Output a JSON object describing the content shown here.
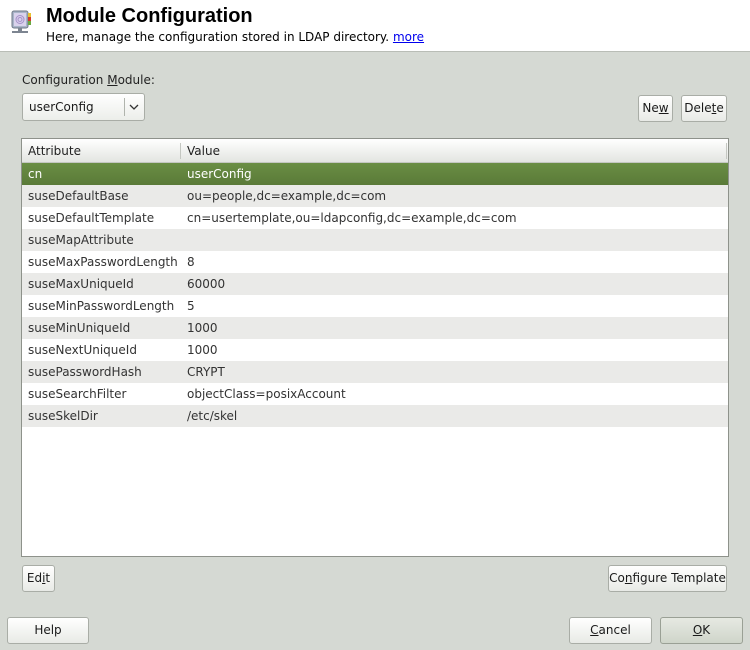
{
  "header": {
    "icon": "ldap-config-computer-icon",
    "title": "Module Configuration",
    "subtitle": "Here, manage the configuration stored in LDAP directory.",
    "more_link": "more"
  },
  "module_selector": {
    "label_prefix": "Configuration ",
    "label_mnemonic": "M",
    "label_suffix": "odule:",
    "selected": "userConfig"
  },
  "toolbar": {
    "new": {
      "pre": "Ne",
      "mn": "w",
      "post": ""
    },
    "delete": {
      "pre": "Dele",
      "mn": "t",
      "post": "e"
    }
  },
  "table": {
    "columns": [
      "Attribute",
      "Value"
    ],
    "rows": [
      {
        "attribute": "cn",
        "value": "userConfig",
        "selected": true
      },
      {
        "attribute": "suseDefaultBase",
        "value": "ou=people,dc=example,dc=com"
      },
      {
        "attribute": "suseDefaultTemplate",
        "value": "cn=usertemplate,ou=ldapconfig,dc=example,dc=com"
      },
      {
        "attribute": "suseMapAttribute",
        "value": ""
      },
      {
        "attribute": "suseMaxPasswordLength",
        "value": "8"
      },
      {
        "attribute": "suseMaxUniqueId",
        "value": "60000"
      },
      {
        "attribute": "suseMinPasswordLength",
        "value": "5"
      },
      {
        "attribute": "suseMinUniqueId",
        "value": "1000"
      },
      {
        "attribute": "suseNextUniqueId",
        "value": "1000"
      },
      {
        "attribute": "susePasswordHash",
        "value": "CRYPT"
      },
      {
        "attribute": "suseSearchFilter",
        "value": "objectClass=posixAccount"
      },
      {
        "attribute": "suseSkelDir",
        "value": "/etc/skel"
      }
    ]
  },
  "actions": {
    "edit": {
      "pre": "Ed",
      "mn": "i",
      "post": "t"
    },
    "configure_template": {
      "pre": "Co",
      "mn": "n",
      "post": "figure Template"
    }
  },
  "footer": {
    "help": "Help",
    "cancel": {
      "pre": "",
      "mn": "C",
      "post": "ancel"
    },
    "ok": {
      "pre": "",
      "mn": "O",
      "post": "K"
    }
  },
  "colors": {
    "selection": "#62843e",
    "background": "#d5d9d3",
    "link": "#0000ee"
  }
}
